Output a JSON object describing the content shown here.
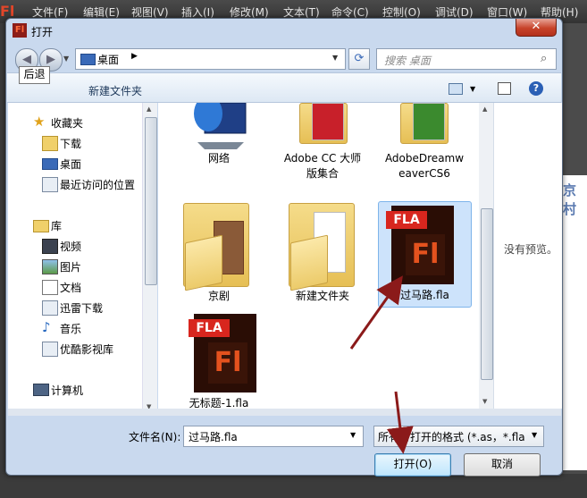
{
  "app": {
    "logo": "Fl",
    "menu": [
      "文件(F)",
      "编辑(E)",
      "视图(V)",
      "插入(I)",
      "修改(M)",
      "文本(T)",
      "命令(C)",
      "控制(O)",
      "调试(D)",
      "窗口(W)",
      "帮助(H)"
    ],
    "doc_text": "京村"
  },
  "dialog": {
    "title": "打开",
    "close": "✕",
    "address": {
      "location": "桌面",
      "separator": "▶"
    },
    "search_placeholder": "搜索 桌面",
    "tooltip": "后退",
    "new_folder": "新建文件夹",
    "help": "?"
  },
  "nav": {
    "favorites_header": "收藏夹",
    "favorites": [
      "下载",
      "桌面",
      "最近访问的位置"
    ],
    "libraries_header": "库",
    "libraries": [
      "视频",
      "图片",
      "文档",
      "迅雷下载",
      "音乐",
      "优酷影视库"
    ],
    "computer": "计算机"
  },
  "files": [
    {
      "name": "网络",
      "icon": "network-icon"
    },
    {
      "name": "Adobe CC 大师版集合",
      "line1": "Adobe CC 大师",
      "line2": "版集合",
      "icon": "folder-icon"
    },
    {
      "name": "AdobeDreamweaverCS6",
      "line1": "AdobeDreamw",
      "line2": "eaverCS6",
      "icon": "folder-icon"
    },
    {
      "name": "京剧",
      "icon": "folder-icon"
    },
    {
      "name": "新建文件夹",
      "icon": "folder-icon"
    },
    {
      "name": "过马路.fla",
      "icon": "fla-file-icon",
      "selected": true
    },
    {
      "name": "无标题-1.fla",
      "icon": "fla-file-icon"
    }
  ],
  "fla_icon": {
    "tab": "FLA",
    "badge": "Fl"
  },
  "preview_text": "没有预览。",
  "footer": {
    "filename_label": "文件名(N):",
    "filename_value": "过马路.fla",
    "filetype_value": "所有可打开的格式 (*.as，*.fla",
    "open_button": "打开(O)",
    "cancel_button": "取消"
  },
  "colors": {
    "accent": "#3c7fb1",
    "selection": "#cde3fb",
    "arrow": "#8b1a1a",
    "fla_red": "#d8261e"
  }
}
